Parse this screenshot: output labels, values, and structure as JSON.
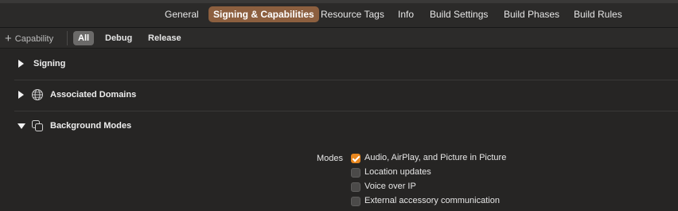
{
  "tabs": [
    {
      "label": "General"
    },
    {
      "label": "Signing & Capabilities"
    },
    {
      "label": "Resource Tags"
    },
    {
      "label": "Info"
    },
    {
      "label": "Build Settings"
    },
    {
      "label": "Build Phases"
    },
    {
      "label": "Build Rules"
    }
  ],
  "active_tab": "Signing & Capabilities",
  "toolbar": {
    "add_capability": "Capability",
    "filters": [
      {
        "label": "All"
      },
      {
        "label": "Debug"
      },
      {
        "label": "Release"
      }
    ],
    "active_filter": "All"
  },
  "sections": [
    {
      "title": "Signing",
      "expanded": false
    },
    {
      "title": "Associated Domains",
      "expanded": false,
      "icon": "globe-icon"
    },
    {
      "title": "Background Modes",
      "expanded": true,
      "icon": "background-modes-icon"
    }
  ],
  "background_modes": {
    "label": "Modes",
    "options": [
      {
        "label": "Audio, AirPlay, and Picture in Picture",
        "checked": true
      },
      {
        "label": "Location updates",
        "checked": false
      },
      {
        "label": "Voice over IP",
        "checked": false
      },
      {
        "label": "External accessory communication",
        "checked": false
      }
    ]
  },
  "colors": {
    "accent": "#8c5f3f",
    "checkbox": "#e8871e",
    "background": "#262524"
  }
}
